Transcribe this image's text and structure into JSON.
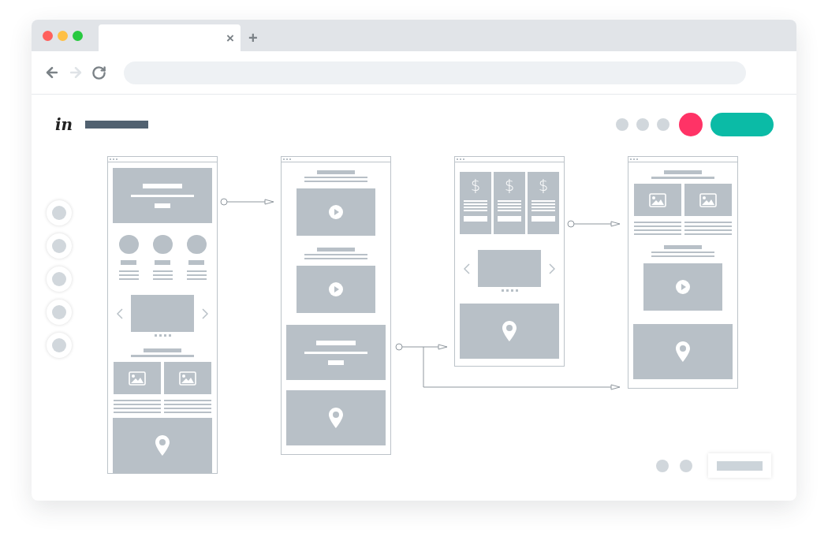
{
  "browser": {
    "tab": {
      "close": "×"
    },
    "new_tab": "+",
    "back": {
      "disabled": false
    },
    "forward": {
      "disabled": true
    }
  },
  "header": {
    "logo": "in"
  },
  "screens": [
    {
      "kind": "landing"
    },
    {
      "kind": "media"
    },
    {
      "kind": "pricing",
      "prices": [
        "$",
        "$",
        "$"
      ]
    },
    {
      "kind": "gallery"
    }
  ]
}
